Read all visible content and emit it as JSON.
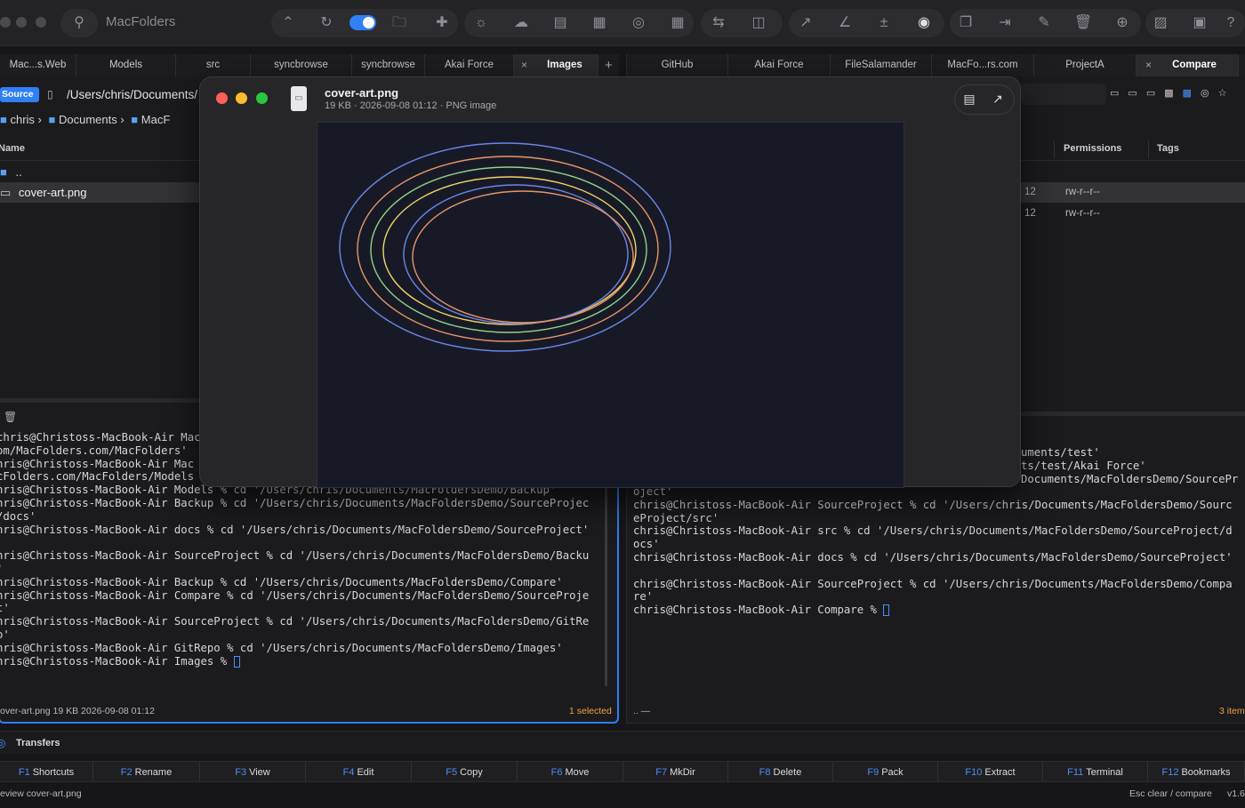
{
  "app": {
    "name": "MacFolders"
  },
  "left_tabs": [
    "Mac...s.Web",
    "Models",
    "src",
    "syncbrowse",
    "syncbrowse",
    "Akai Force",
    "Images"
  ],
  "right_tabs": [
    "GitHub",
    "Akai Force",
    "FileSalamander",
    "MacFo...rs.com",
    "ProjectA",
    "Compare"
  ],
  "left": {
    "source_badge": "Source",
    "path": "/Users/chris/Documents/",
    "breadcrumb": [
      "chris",
      "Documents",
      "MacF"
    ],
    "col_name": "Name",
    "files": [
      {
        "name": ".."
      },
      {
        "name": "cover-art.png"
      }
    ],
    "terminal": "chris@Christoss-MacBook-Air Mac\nom/MacFolders.com/MacFolders'\nhris@Christoss-MacBook-Air Mac\ncFolders.com/MacFolders/Models\nhris@Christoss-MacBook-Air Models % cd '/Users/chris/Documents/MacFoldersDemo/Backup'\nhris@Christoss-MacBook-Air Backup % cd '/Users/chris/Documents/MacFoldersDemo/SourceProjec\n/docs'\nhris@Christoss-MacBook-Air docs % cd '/Users/chris/Documents/MacFoldersDemo/SourceProject'\n\nhris@Christoss-MacBook-Air SourceProject % cd '/Users/chris/Documents/MacFoldersDemo/Backu\n'\nhris@Christoss-MacBook-Air Backup % cd '/Users/chris/Documents/MacFoldersDemo/Compare'\nhris@Christoss-MacBook-Air Compare % cd '/Users/chris/Documents/MacFoldersDemo/SourceProje\nt'\nhris@Christoss-MacBook-Air SourceProject % cd '/Users/chris/Documents/MacFoldersDemo/GitRe\no'\nhris@Christoss-MacBook-Air GitRepo % cd '/Users/chris/Documents/MacFoldersDemo/Images'\nhris@Christoss-MacBook-Air Images % ",
    "status_file": "over-art.png  19 KB  2026-09-08 01:12",
    "status_selected": "1 selected"
  },
  "right": {
    "col_permissions": "Permissions",
    "col_tags": "Tags",
    "rows": [
      {
        "date": "12",
        "perm": "rw-r--r--"
      },
      {
        "date": "12",
        "perm": "rw-r--r--"
      }
    ],
    "terminal": "uments/test'\nts/test/Akai Force'\nDocuments/MacFoldersDemo/SourcePr\noject'\nchris@Christoss-MacBook-Air SourceProject % cd '/Users/chris/Documents/MacFoldersDemo/Sourc\neProject/src'\nchris@Christoss-MacBook-Air src % cd '/Users/chris/Documents/MacFoldersDemo/SourceProject/d\nocs'\nchris@Christoss-MacBook-Air docs % cd '/Users/chris/Documents/MacFoldersDemo/SourceProject'\n\nchris@Christoss-MacBook-Air SourceProject % cd '/Users/chris/Documents/MacFoldersDemo/Compa\nre'\nchris@Christoss-MacBook-Air Compare % ",
    "status_left": ".. —",
    "status_right": "3 item"
  },
  "quicklook": {
    "filename": "cover-art.png",
    "meta": "19 KB  ·  2026-09-08 01:12  ·  PNG image",
    "ring_colors": [
      "#6b86e6",
      "#e8956a",
      "#8fd18a",
      "#f0d468",
      "#6b86e6",
      "#e8956a"
    ]
  },
  "transfers": {
    "label": "Transfers"
  },
  "fkeys": [
    {
      "key": "F1",
      "label": "Shortcuts"
    },
    {
      "key": "F2",
      "label": "Rename"
    },
    {
      "key": "F3",
      "label": "View"
    },
    {
      "key": "F4",
      "label": "Edit"
    },
    {
      "key": "F5",
      "label": "Copy"
    },
    {
      "key": "F6",
      "label": "Move"
    },
    {
      "key": "F7",
      "label": "MkDir"
    },
    {
      "key": "F8",
      "label": "Delete"
    },
    {
      "key": "F9",
      "label": "Pack"
    },
    {
      "key": "F10",
      "label": "Extract"
    },
    {
      "key": "F11",
      "label": "Terminal"
    },
    {
      "key": "F12",
      "label": "Bookmarks"
    }
  ],
  "statusbar": {
    "left": "eview cover-art.png",
    "hint": "Esc clear / compare",
    "version": "v1.6"
  },
  "colors": {
    "accent": "#2f7ff5",
    "selected_text": "#f0a040"
  }
}
